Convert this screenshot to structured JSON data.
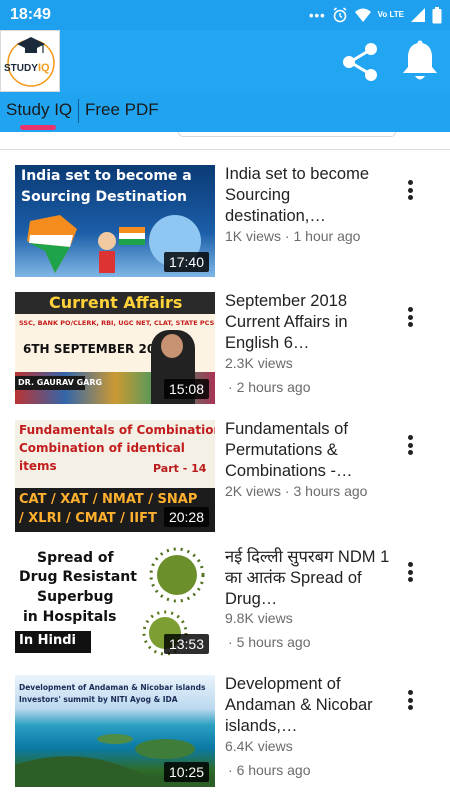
{
  "status_bar": {
    "time": "18:49",
    "dots": "•••",
    "network": "Vo LTE"
  },
  "app_bar": {
    "logo_text": "STUDY IQ",
    "logo_text_a": "STUDY",
    "logo_text_b": "IQ",
    "share_icon": "share-icon",
    "bell_icon": "bell-icon",
    "background": "#22a6f2"
  },
  "tabs": [
    {
      "label": "Study IQ",
      "active": true
    },
    {
      "label": "Free PDF",
      "active": false
    }
  ],
  "videos": [
    {
      "title": "India set to become Sourcing destination,…",
      "views": "1K views",
      "time": "1 hour ago",
      "duration": "17:40",
      "thumb_text": [
        "India set to become a",
        "Sourcing Destination"
      ]
    },
    {
      "title": "September 2018 Current Affairs in English 6…",
      "views": "2.3K views",
      "time": "2 hours ago",
      "duration": "15:08",
      "thumb_text": [
        "Current Affairs",
        "SSC, BANK PO/CLERK, RBI, UGC NET, CLAT, STATE PCS",
        "6TH SEPTEMBER 2018",
        "DR. GAURAV GARG"
      ]
    },
    {
      "title": "Fundamentals of Permutations & Combinations -…",
      "views": "2K views",
      "time": "3 hours ago",
      "duration": "20:28",
      "thumb_text": [
        "Fundamentals of Combination",
        "Combination of identical",
        "items",
        "Part - 14",
        "CAT / XAT / NMAT / SNAP",
        "/ XLRI / CMAT / IIFT"
      ]
    },
    {
      "title": "नई दिल्ली सुपरबग NDM 1 का आतंक Spread of Drug…",
      "views": "9.8K views",
      "time": "5 hours ago",
      "duration": "13:53",
      "thumb_text": [
        "Spread of",
        "Drug Resistant",
        "Superbug",
        "in Hospitals",
        "In Hindi"
      ]
    },
    {
      "title": "Development of Andaman & Nicobar islands,…",
      "views": "6.4K views",
      "time": "6 hours ago",
      "duration": "10:25",
      "thumb_text": [
        "Development of Andaman & Nicobar islands",
        "Investors' summit by NITI Ayog & IDA"
      ]
    }
  ]
}
